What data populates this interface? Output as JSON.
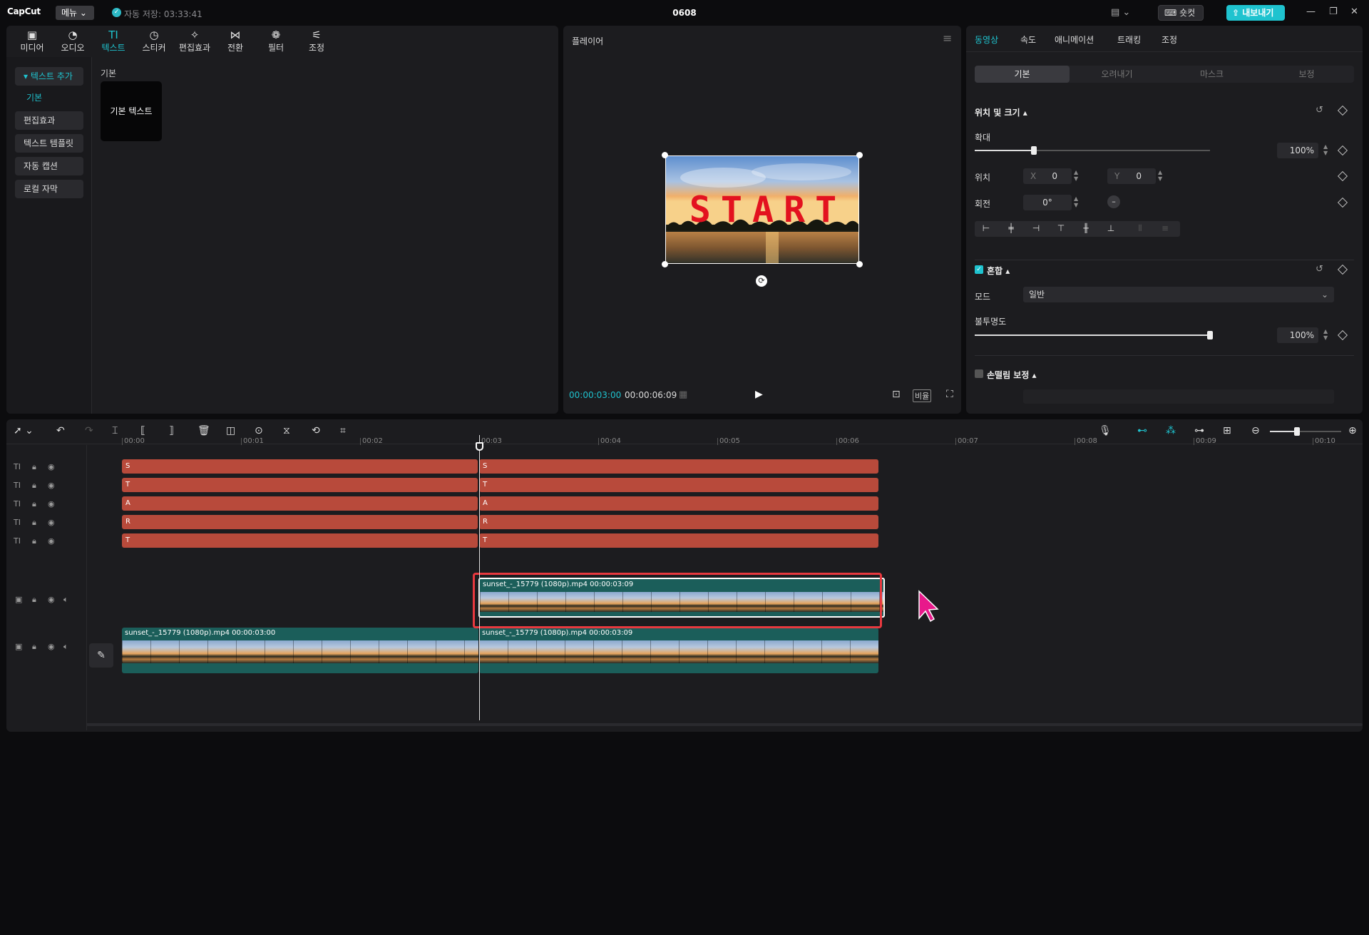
{
  "titlebar": {
    "logo": "CapCut",
    "menu_label": "메뉴 ⌄",
    "autosave": "자동 저장: 03:33:41",
    "project_title": "0608",
    "layout_icon": "layout-icon",
    "shortcut_label": "⌨ 숏컷",
    "export_label": "⇪ 내보내기"
  },
  "media_tabs": [
    {
      "icon": "▣",
      "label": "미디어"
    },
    {
      "icon": "◔",
      "label": "오디오"
    },
    {
      "icon": "TI",
      "label": "텍스트"
    },
    {
      "icon": "◷",
      "label": "스티커"
    },
    {
      "icon": "✧",
      "label": "편집효과"
    },
    {
      "icon": "⋈",
      "label": "전환"
    },
    {
      "icon": "❁",
      "label": "필터"
    },
    {
      "icon": "⚟",
      "label": "조정"
    }
  ],
  "text_sidebar": {
    "add_text": "▾ 텍스트 추가",
    "basic": "기본",
    "items": [
      "편집효과",
      "텍스트 템플릿",
      "자동 캡션",
      "로컬 자막"
    ]
  },
  "text_library": {
    "section": "기본",
    "card": "기본 텍스트"
  },
  "player": {
    "title": "플레이어",
    "overlay_text": "START",
    "current_time": "00:00:03:00",
    "total_time": "00:00:06:09",
    "ratio_label": "비율"
  },
  "inspector": {
    "tabs": [
      "동영상",
      "속도",
      "애니메이션",
      "트래킹",
      "조정"
    ],
    "subtabs": [
      "기본",
      "오려내기",
      "마스크",
      "보정"
    ],
    "position_size": "위치 및 크기 ▴",
    "scale_label": "확대",
    "scale_value": "100%",
    "scale_level": 0.25,
    "position_label": "위치",
    "pos_x_label": "X",
    "pos_x": "0",
    "pos_y_label": "Y",
    "pos_y": "0",
    "rotate_label": "회전",
    "rotate_value": "0°",
    "blend_label": "혼합 ▴",
    "mode_label": "모드",
    "mode_value": "일반",
    "opacity_label": "불투명도",
    "opacity_value": "100%",
    "opacity_level": 1.0,
    "stabilize_label": "손떨림 보정 ▴"
  },
  "timeline": {
    "ruler": [
      "00:00",
      "00:01",
      "00:02",
      "00:03",
      "00:04",
      "00:05",
      "00:06",
      "00:07",
      "00:08",
      "00:09",
      "00:10"
    ],
    "text_tracks": [
      {
        "left": "S",
        "right": "S"
      },
      {
        "left": "T",
        "right": "T"
      },
      {
        "left": "A",
        "right": "A"
      },
      {
        "left": "R",
        "right": "R"
      },
      {
        "left": "T",
        "right": "T"
      }
    ],
    "overlay_clip": "sunset_-_15779 (1080p).mp4   00:00:03:09",
    "main_clip_a": "sunset_-_15779 (1080p).mp4   00:00:03:00",
    "main_clip_b": "sunset_-_15779 (1080p).mp4   00:00:03:09"
  },
  "colors": {
    "accent": "#1fc3cf",
    "text_clip": "#b84a3b",
    "video_clip": "#1b5e5a",
    "selection": "#e8393f",
    "cursor": "#e8198b"
  }
}
